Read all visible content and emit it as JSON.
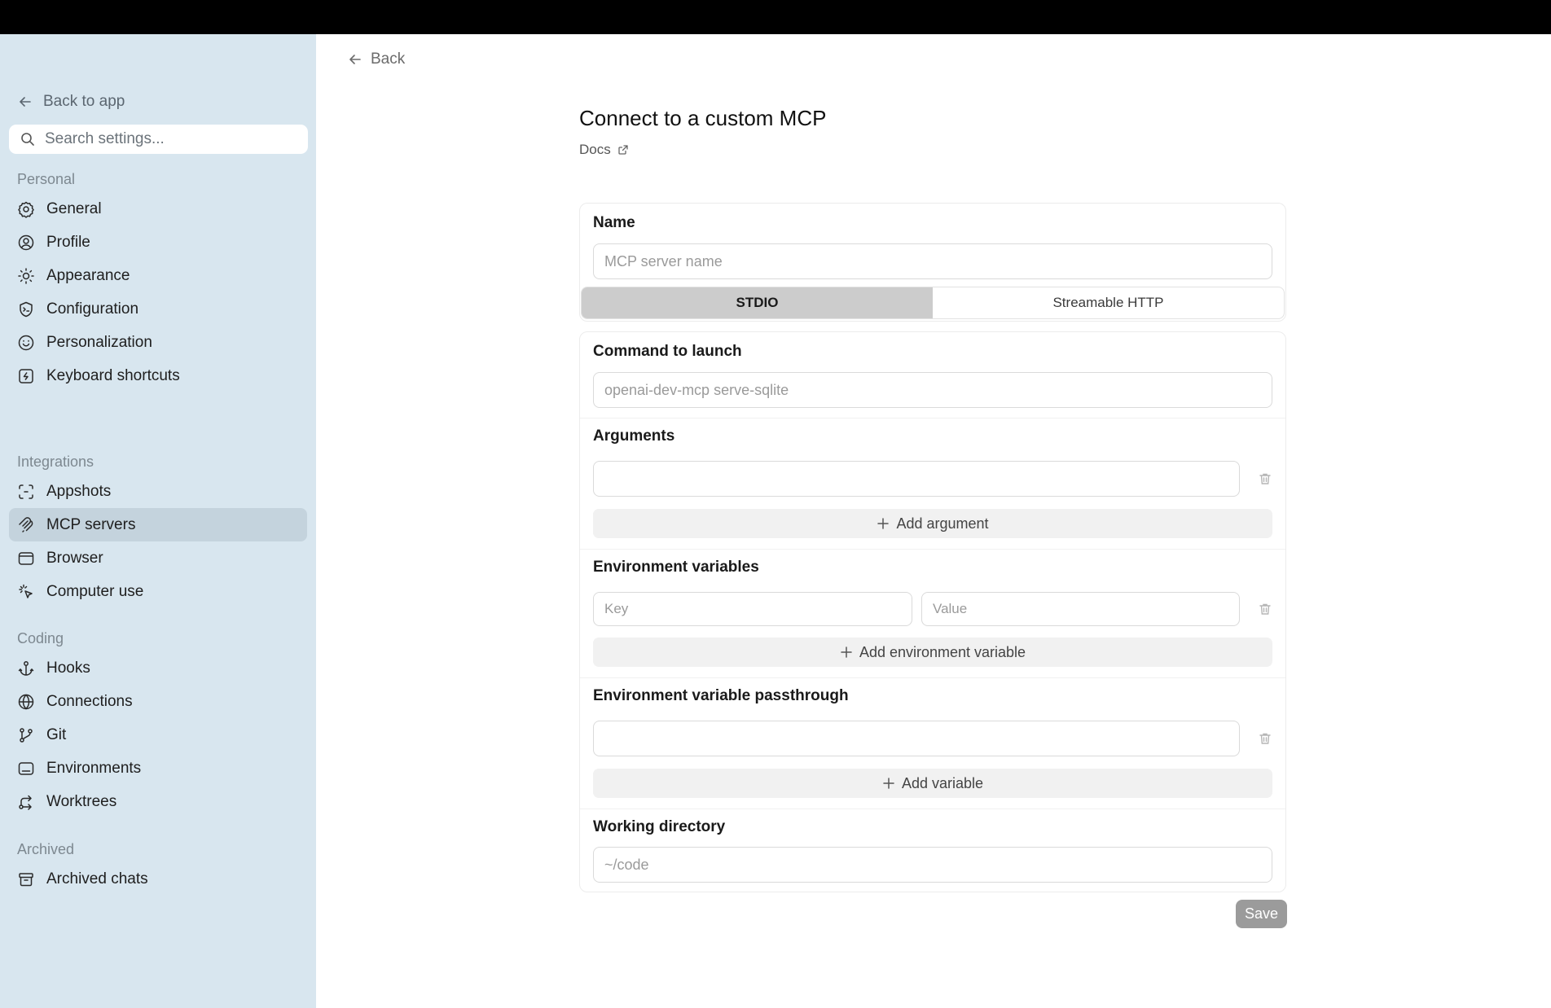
{
  "sidebar": {
    "back_label": "Back to app",
    "search_placeholder": "Search settings...",
    "sections": [
      {
        "label": "Personal",
        "items": [
          "General",
          "Profile",
          "Appearance",
          "Configuration",
          "Personalization",
          "Keyboard shortcuts"
        ]
      },
      {
        "label": "Integrations",
        "items": [
          "Appshots",
          "MCP servers",
          "Browser",
          "Computer use"
        ]
      },
      {
        "label": "Coding",
        "items": [
          "Hooks",
          "Connections",
          "Git",
          "Environments",
          "Worktrees"
        ]
      },
      {
        "label": "Archived",
        "items": [
          "Archived chats"
        ]
      }
    ],
    "active_item": "MCP servers"
  },
  "main": {
    "back_label": "Back",
    "title": "Connect to a custom MCP",
    "docs_label": "Docs",
    "name_label": "Name",
    "name_placeholder": "MCP server name",
    "transport_tabs": [
      "STDIO",
      "Streamable HTTP"
    ],
    "active_transport": "STDIO",
    "command_label": "Command to launch",
    "command_placeholder": "openai-dev-mcp serve-sqlite",
    "arguments_label": "Arguments",
    "add_argument_label": "Add argument",
    "env_label": "Environment variables",
    "env_key_placeholder": "Key",
    "env_value_placeholder": "Value",
    "add_env_label": "Add environment variable",
    "passthrough_label": "Environment variable passthrough",
    "add_variable_label": "Add variable",
    "workdir_label": "Working directory",
    "workdir_placeholder": "~/code",
    "save_label": "Save"
  }
}
